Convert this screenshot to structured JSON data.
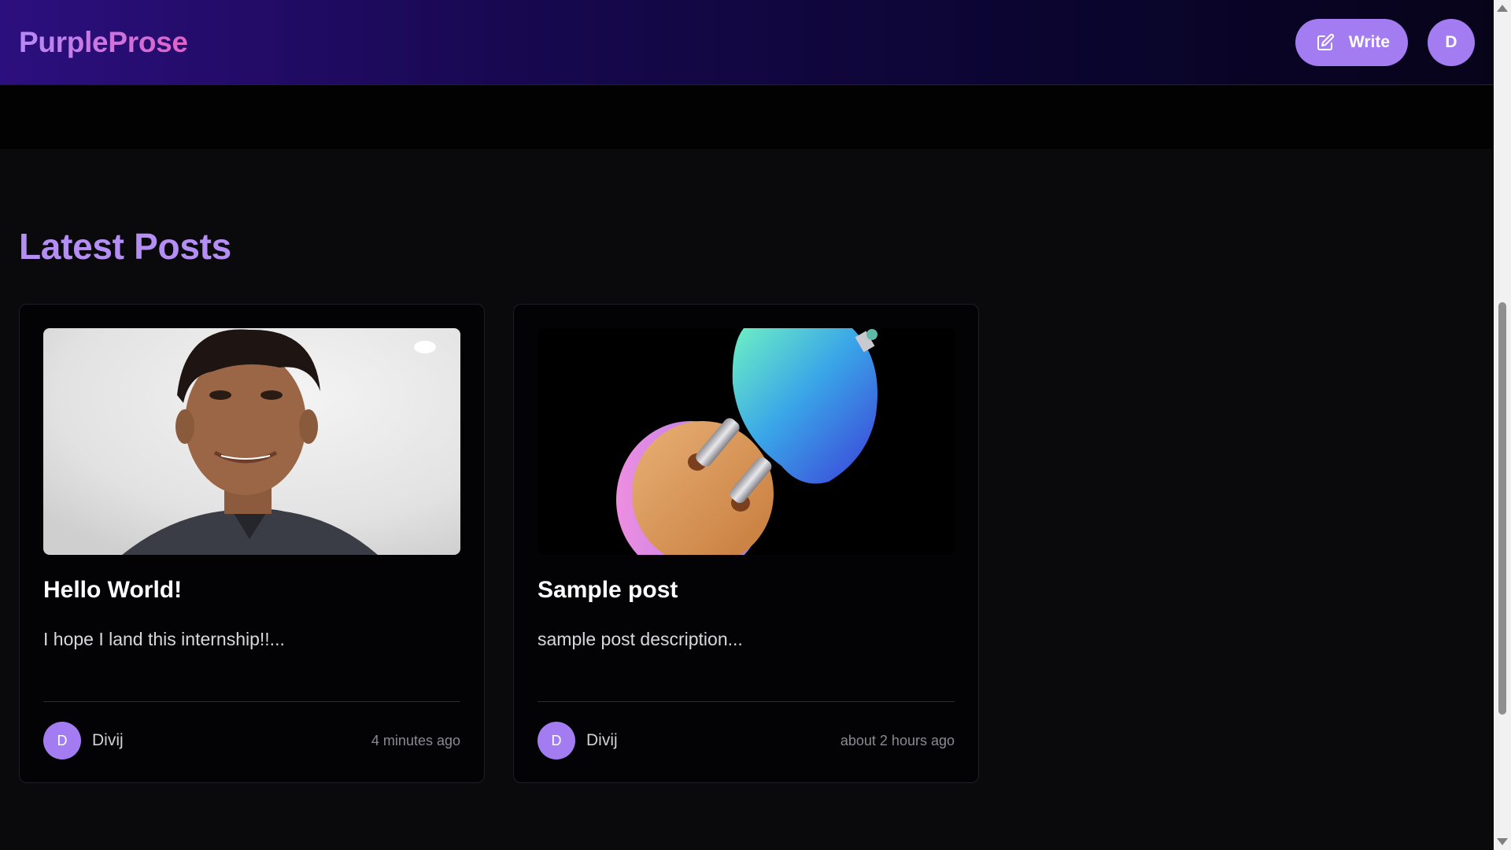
{
  "navbar": {
    "logo": "PurpleProse",
    "write_label": "Write",
    "user_initial": "D"
  },
  "main": {
    "section_title": "Latest Posts",
    "posts": [
      {
        "title": "Hello World!",
        "description": "I hope I land this internship!!...",
        "author_initial": "D",
        "author": "Divij",
        "time": "4 minutes ago",
        "image_icon": "portrait-photo"
      },
      {
        "title": "Sample post",
        "description": "sample post description...",
        "author_initial": "D",
        "author": "Divij",
        "time": "about 2 hours ago",
        "image_icon": "abstract-3d-render"
      }
    ]
  },
  "colors": {
    "accent": "#a47cf2",
    "title": "#b48ef4",
    "background": "#0a0a0c"
  }
}
